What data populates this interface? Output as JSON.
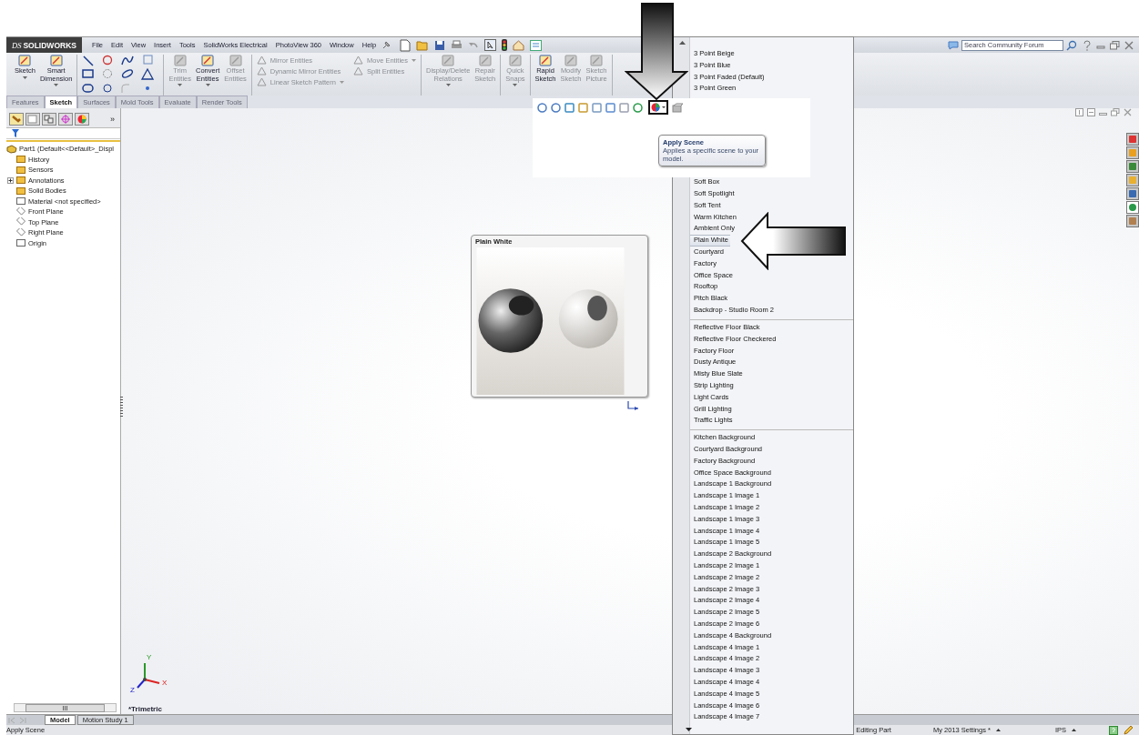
{
  "title_bar": {
    "logo_mark": "DS",
    "logo": "SOLIDWORKS",
    "menu": [
      "File",
      "Edit",
      "View",
      "Insert",
      "Tools",
      "SolidWorks Electrical",
      "PhotoView 360",
      "Window",
      "Help"
    ],
    "search": {
      "placeholder": "Search Community Forum"
    }
  },
  "command_manager": {
    "groups": [
      {
        "kind": "large",
        "items": [
          {
            "label": "Sketch",
            "disabled": false,
            "menu": true
          },
          {
            "label": "Smart Dimension",
            "disabled": false,
            "menu": true
          }
        ]
      },
      {
        "kind": "grid"
      },
      {
        "kind": "large",
        "items": [
          {
            "label": "Trim Entities",
            "disabled": true,
            "menu": true
          },
          {
            "label": "Convert Entities",
            "disabled": false,
            "menu": true
          },
          {
            "label": "Offset Entities",
            "disabled": true,
            "menu": false
          }
        ]
      },
      {
        "kind": "small",
        "items": [
          {
            "label": "Mirror Entities",
            "disabled": true,
            "menu": false
          },
          {
            "label": "Dynamic Mirror Entities",
            "disabled": true,
            "menu": false
          },
          {
            "label": "Linear Sketch Pattern",
            "disabled": true,
            "menu": true
          }
        ]
      },
      {
        "kind": "small",
        "items": [
          {
            "label": "Move Entities",
            "disabled": true,
            "menu": true
          },
          {
            "label": "Split Entities",
            "disabled": true,
            "menu": false
          }
        ]
      },
      {
        "kind": "large",
        "items": [
          {
            "label": "Display/Delete Relations",
            "disabled": true,
            "menu": true
          },
          {
            "label": "Repair Sketch",
            "disabled": true,
            "menu": false
          }
        ]
      },
      {
        "kind": "large",
        "items": [
          {
            "label": "Quick Snaps",
            "disabled": true,
            "menu": true
          }
        ]
      },
      {
        "kind": "large",
        "items": [
          {
            "label": "Rapid Sketch",
            "disabled": false,
            "menu": false
          },
          {
            "label": "Modify Sketch",
            "disabled": true,
            "menu": false
          },
          {
            "label": "Sketch Picture",
            "disabled": true,
            "menu": false
          }
        ]
      }
    ]
  },
  "tabs": [
    {
      "label": "Features",
      "selected": false
    },
    {
      "label": "Sketch",
      "selected": true
    },
    {
      "label": "Surfaces",
      "selected": false
    },
    {
      "label": "Mold Tools",
      "selected": false
    },
    {
      "label": "Evaluate",
      "selected": false
    },
    {
      "label": "Render Tools",
      "selected": false
    }
  ],
  "feature_tree": {
    "more": "»",
    "root": {
      "label": "Part1  (Default<<Default>_Displ",
      "children": [
        {
          "label": "History"
        },
        {
          "label": "Sensors"
        },
        {
          "label": "Annotations",
          "expanded": false
        },
        {
          "label": "Solid Bodies"
        },
        {
          "label": "Material <not specified>"
        },
        {
          "label": "Front Plane"
        },
        {
          "label": "Top Plane"
        },
        {
          "label": "Right Plane"
        },
        {
          "label": "Origin"
        }
      ]
    },
    "scrollbar_grip": "III"
  },
  "tooltip": {
    "title": "Apply Scene",
    "text": "Applies a specific scene to your model."
  },
  "preview": {
    "title": "Plain White"
  },
  "scene_menu": {
    "items_above": [
      {
        "label": "3 Point Beige",
        "selected": false
      },
      {
        "label": "3 Point Blue",
        "selected": false
      },
      {
        "label": "3 Point Faded  (Default)",
        "selected": false
      },
      {
        "label": "3 Point Green",
        "selected": false
      }
    ],
    "groups": [
      [
        {
          "label": "Soft Box",
          "selected": false
        },
        {
          "label": "Soft Spotlight",
          "selected": false
        },
        {
          "label": "Soft Tent",
          "selected": false
        },
        {
          "label": "Warm Kitchen",
          "selected": false
        },
        {
          "label": "Ambient Only",
          "selected": false
        },
        {
          "label": "Plain White",
          "selected": true
        },
        {
          "label": "Courtyard",
          "selected": false
        },
        {
          "label": "Factory",
          "selected": false
        },
        {
          "label": "Office Space",
          "selected": false
        },
        {
          "label": "Rooftop",
          "selected": false
        },
        {
          "label": "Pitch Black",
          "selected": false
        },
        {
          "label": "Backdrop - Studio Room 2",
          "selected": false
        }
      ],
      [
        {
          "label": "Reflective Floor Black",
          "selected": false
        },
        {
          "label": "Reflective Floor Checkered",
          "selected": false
        },
        {
          "label": "Factory Floor",
          "selected": false
        },
        {
          "label": "Dusty Antique",
          "selected": false
        },
        {
          "label": "Misty Blue Slate",
          "selected": false
        },
        {
          "label": "Strip Lighting",
          "selected": false
        },
        {
          "label": "Light Cards",
          "selected": false
        },
        {
          "label": "Grill Lighting",
          "selected": false
        },
        {
          "label": "Traffic Lights",
          "selected": false
        }
      ],
      [
        {
          "label": "Kitchen Background",
          "selected": false
        },
        {
          "label": "Courtyard Background",
          "selected": false
        },
        {
          "label": "Factory Background",
          "selected": false
        },
        {
          "label": "Office Space Background",
          "selected": false
        },
        {
          "label": "Landscape 1 Background",
          "selected": false
        },
        {
          "label": "Landscape 1 Image 1",
          "selected": false
        },
        {
          "label": "Landscape 1 Image 2",
          "selected": false
        },
        {
          "label": "Landscape 1 Image 3",
          "selected": false
        },
        {
          "label": "Landscape 1 Image 4",
          "selected": false
        },
        {
          "label": "Landscape 1 Image 5",
          "selected": false
        },
        {
          "label": "Landscape 2 Background",
          "selected": false
        },
        {
          "label": "Landscape 2 Image 1",
          "selected": false
        },
        {
          "label": "Landscape 2 Image 2",
          "selected": false
        },
        {
          "label": "Landscape 2 Image 3",
          "selected": false
        },
        {
          "label": "Landscape 2 Image 4",
          "selected": false
        },
        {
          "label": "Landscape 2 Image 5",
          "selected": false
        },
        {
          "label": "Landscape 2 Image 6",
          "selected": false
        },
        {
          "label": "Landscape 4 Background",
          "selected": false
        },
        {
          "label": "Landscape 4 Image 1",
          "selected": false
        },
        {
          "label": "Landscape 4 Image 2",
          "selected": false
        },
        {
          "label": "Landscape 4 Image 3",
          "selected": false
        },
        {
          "label": "Landscape 4 Image 4",
          "selected": false
        },
        {
          "label": "Landscape 4 Image 5",
          "selected": false
        },
        {
          "label": "Landscape 4 Image 6",
          "selected": false
        },
        {
          "label": "Landscape 4 Image 7",
          "selected": false
        }
      ]
    ]
  },
  "viewport": {
    "view_name": "*Trimetric",
    "triad": {
      "y": "Y",
      "x": "X",
      "z": "Z"
    }
  },
  "bottom_tabs": [
    {
      "label": "Model",
      "selected": true
    },
    {
      "label": "Motion Study 1",
      "selected": false
    }
  ],
  "status_bar": {
    "message": "Apply Scene",
    "state": "Editing Part",
    "settings": "My 2013 Settings *",
    "units": "IPS"
  }
}
